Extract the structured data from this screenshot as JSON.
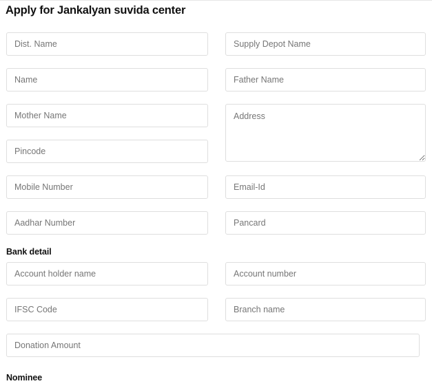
{
  "page": {
    "title": "Apply for Jankalyan suvida center"
  },
  "form": {
    "fields": {
      "dist_name": {
        "placeholder": "Dist. Name",
        "value": ""
      },
      "supply_depot_name": {
        "placeholder": "Supply Depot Name",
        "value": ""
      },
      "name": {
        "placeholder": "Name",
        "value": ""
      },
      "father_name": {
        "placeholder": "Father Name",
        "value": ""
      },
      "mother_name": {
        "placeholder": "Mother Name",
        "value": ""
      },
      "address": {
        "placeholder": "Address",
        "value": ""
      },
      "pincode": {
        "placeholder": "Pincode",
        "value": ""
      },
      "mobile_number": {
        "placeholder": "Mobile Number",
        "value": ""
      },
      "email_id": {
        "placeholder": "Email-Id",
        "value": ""
      },
      "aadhar_number": {
        "placeholder": "Aadhar Number",
        "value": ""
      },
      "pancard": {
        "placeholder": "Pancard",
        "value": ""
      }
    }
  },
  "bank_section": {
    "heading": "Bank detail",
    "fields": {
      "account_holder_name": {
        "placeholder": "Account holder name",
        "value": ""
      },
      "account_number": {
        "placeholder": "Account number",
        "value": ""
      },
      "ifsc_code": {
        "placeholder": "IFSC Code",
        "value": ""
      },
      "branch_name": {
        "placeholder": "Branch name",
        "value": ""
      },
      "donation_amount": {
        "placeholder": "Donation Amount",
        "value": ""
      }
    }
  },
  "nominee_section": {
    "heading": "Nominee"
  },
  "colors": {
    "field_border": "#dedede",
    "placeholder_text": "#767676",
    "heading_text": "#111111",
    "background": "#ffffff"
  }
}
